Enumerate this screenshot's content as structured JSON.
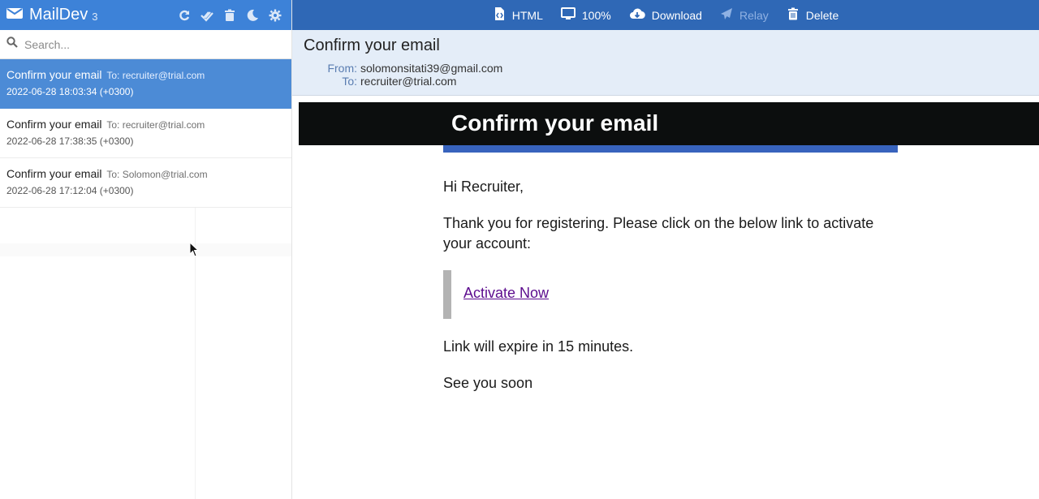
{
  "app": {
    "name": "MailDev",
    "count": "3"
  },
  "search": {
    "placeholder": "Search..."
  },
  "emails": [
    {
      "subject": "Confirm your email",
      "to": "To: recruiter@trial.com",
      "date": "2022-06-28 18:03:34 (+0300)"
    },
    {
      "subject": "Confirm your email",
      "to": "To: recruiter@trial.com",
      "date": "2022-06-28 17:38:35 (+0300)"
    },
    {
      "subject": "Confirm your email",
      "to": "To: Solomon@trial.com",
      "date": "2022-06-28 17:12:04 (+0300)"
    }
  ],
  "toolbar": {
    "html": "HTML",
    "zoom": "100%",
    "download": "Download",
    "relay": "Relay",
    "delete": "Delete"
  },
  "message": {
    "subject": "Confirm your email",
    "from_label": "From:",
    "from": "solomonsitati39@gmail.com",
    "to_label": "To:",
    "to": "recruiter@trial.com"
  },
  "email_body": {
    "banner_title": "Confirm your email",
    "greeting": "Hi Recruiter,",
    "paragraph": "Thank you for registering. Please click on the below link to activate your account:",
    "link": "Activate Now",
    "expiry": "Link will expire in 15 minutes.",
    "closing": "See you soon"
  },
  "colors": {
    "sidebar_header": "#3d82d8",
    "toolbar": "#2f68b6",
    "active_item": "#4c8bd6",
    "banner": "#0c0e0e",
    "strip": "#3863bd",
    "link": "#5c0c8e"
  }
}
